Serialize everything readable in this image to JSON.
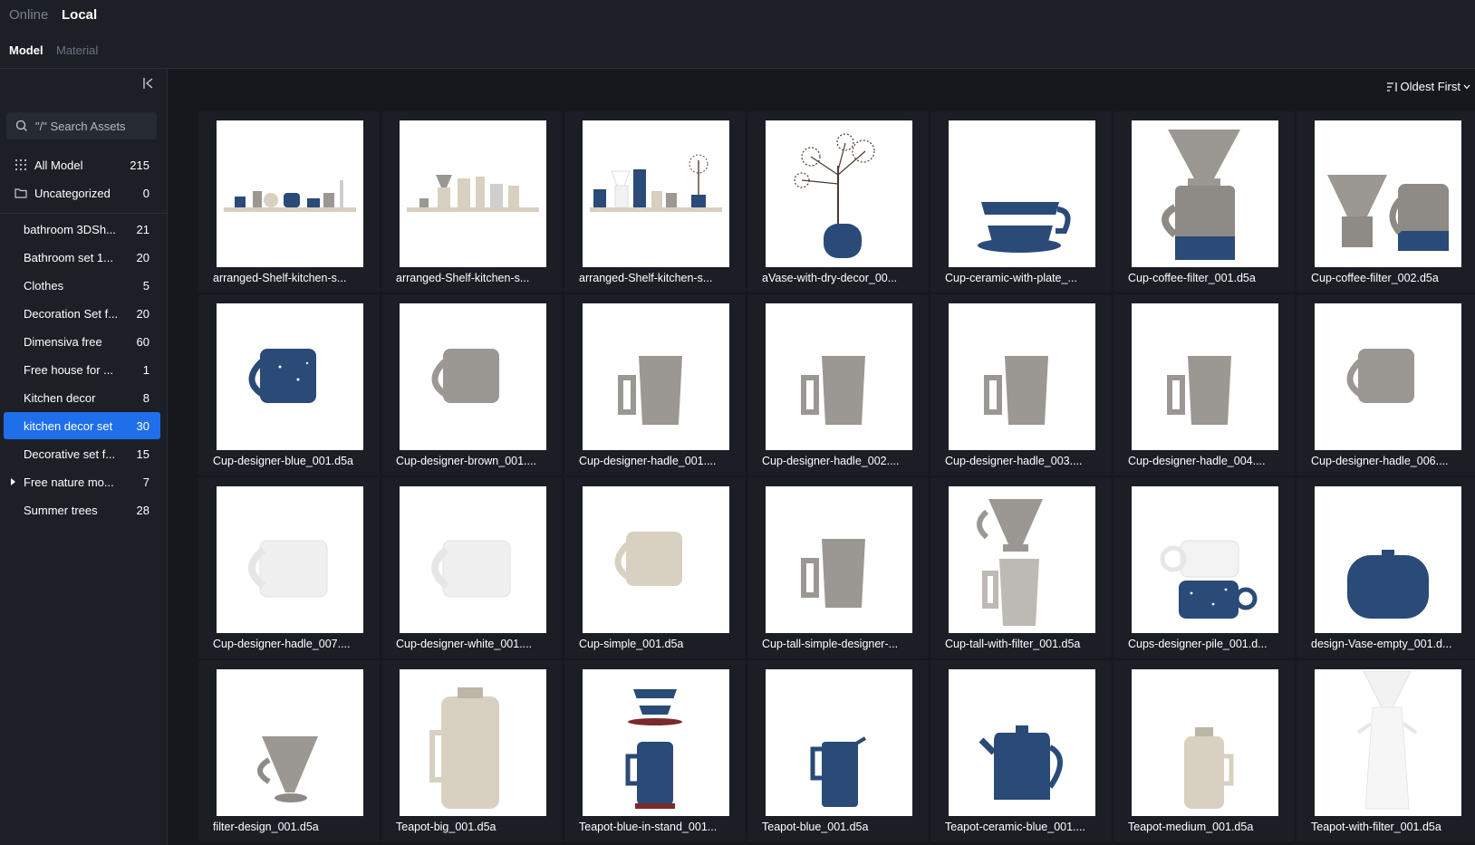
{
  "header": {
    "tabs": [
      {
        "label": "Online",
        "active": false
      },
      {
        "label": "Local",
        "active": true
      }
    ],
    "subtabs": [
      {
        "label": "Model",
        "active": true
      },
      {
        "label": "Material",
        "active": false
      }
    ]
  },
  "sidebar": {
    "collapse_icon": "collapse-left-icon",
    "search": {
      "placeholder": "\"/\" Search Assets"
    },
    "categories": [
      {
        "label": "All Model",
        "count": "215",
        "icon": "grid-dots-icon"
      },
      {
        "label": "Uncategorized",
        "count": "0",
        "icon": "folder-icon"
      }
    ],
    "folders": [
      {
        "label": "bathroom 3DSh...",
        "count": "21"
      },
      {
        "label": "Bathroom set 1...",
        "count": "20"
      },
      {
        "label": "Clothes",
        "count": "5"
      },
      {
        "label": "Decoration Set f...",
        "count": "20"
      },
      {
        "label": "Dimensiva free",
        "count": "60"
      },
      {
        "label": "Free house for ...",
        "count": "1"
      },
      {
        "label": "Kitchen decor",
        "count": "8"
      },
      {
        "label": "kitchen decor set",
        "count": "30",
        "selected": true
      },
      {
        "label": "Decorative set f...",
        "count": "15"
      },
      {
        "label": "Free nature mo...",
        "count": "7",
        "expandable": true
      },
      {
        "label": "Summer trees",
        "count": "28"
      }
    ]
  },
  "main": {
    "sort_label": "Oldest First",
    "assets": [
      {
        "name": "arranged-Shelf-kitchen-s...",
        "thumb": "shelf1"
      },
      {
        "name": "arranged-Shelf-kitchen-s...",
        "thumb": "shelf2"
      },
      {
        "name": "arranged-Shelf-kitchen-s...",
        "thumb": "shelf3"
      },
      {
        "name": "aVase-with-dry-decor_00...",
        "thumb": "vase-dry"
      },
      {
        "name": "Cup-ceramic-with-plate_...",
        "thumb": "cup-plate"
      },
      {
        "name": "Cup-coffee-filter_001.d5a",
        "thumb": "filter-cup"
      },
      {
        "name": "Cup-coffee-filter_002.d5a",
        "thumb": "filter-pair"
      },
      {
        "name": "Cup-designer-blue_001.d5a",
        "thumb": "mug-blue"
      },
      {
        "name": "Cup-designer-brown_001....",
        "thumb": "mug-gray"
      },
      {
        "name": "Cup-designer-hadle_001....",
        "thumb": "tall-gray"
      },
      {
        "name": "Cup-designer-hadle_002....",
        "thumb": "tall-gray"
      },
      {
        "name": "Cup-designer-hadle_003....",
        "thumb": "tall-gray"
      },
      {
        "name": "Cup-designer-hadle_004....",
        "thumb": "tall-gray"
      },
      {
        "name": "Cup-designer-hadle_006....",
        "thumb": "mug-gray"
      },
      {
        "name": "Cup-designer-hadle_007....",
        "thumb": "mug-white"
      },
      {
        "name": "Cup-designer-white_001....",
        "thumb": "mug-white"
      },
      {
        "name": "Cup-simple_001.d5a",
        "thumb": "mug-beige"
      },
      {
        "name": "Cup-tall-simple-designer-...",
        "thumb": "tall-gray"
      },
      {
        "name": "Cup-tall-with-filter_001.d5a",
        "thumb": "tall-filter"
      },
      {
        "name": "Cups-designer-pile_001.d...",
        "thumb": "cup-pile"
      },
      {
        "name": "design-Vase-empty_001.d...",
        "thumb": "vase-blue"
      },
      {
        "name": "filter-design_001.d5a",
        "thumb": "filter-cone"
      },
      {
        "name": "Teapot-big_001.d5a",
        "thumb": "teapot-beige"
      },
      {
        "name": "Teapot-blue-in-stand_001...",
        "thumb": "teapot-stand"
      },
      {
        "name": "Teapot-blue_001.d5a",
        "thumb": "jug-blue"
      },
      {
        "name": "Teapot-ceramic-blue_001....",
        "thumb": "kettle-blue"
      },
      {
        "name": "Teapot-medium_001.d5a",
        "thumb": "teapot-beige-small"
      },
      {
        "name": "Teapot-with-filter_001.d5a",
        "thumb": "teapot-white"
      }
    ]
  },
  "colors": {
    "accent": "#1f6fea",
    "navy": "#2a4a78",
    "stone": "#9b9894",
    "beige": "#d8d0c0"
  }
}
